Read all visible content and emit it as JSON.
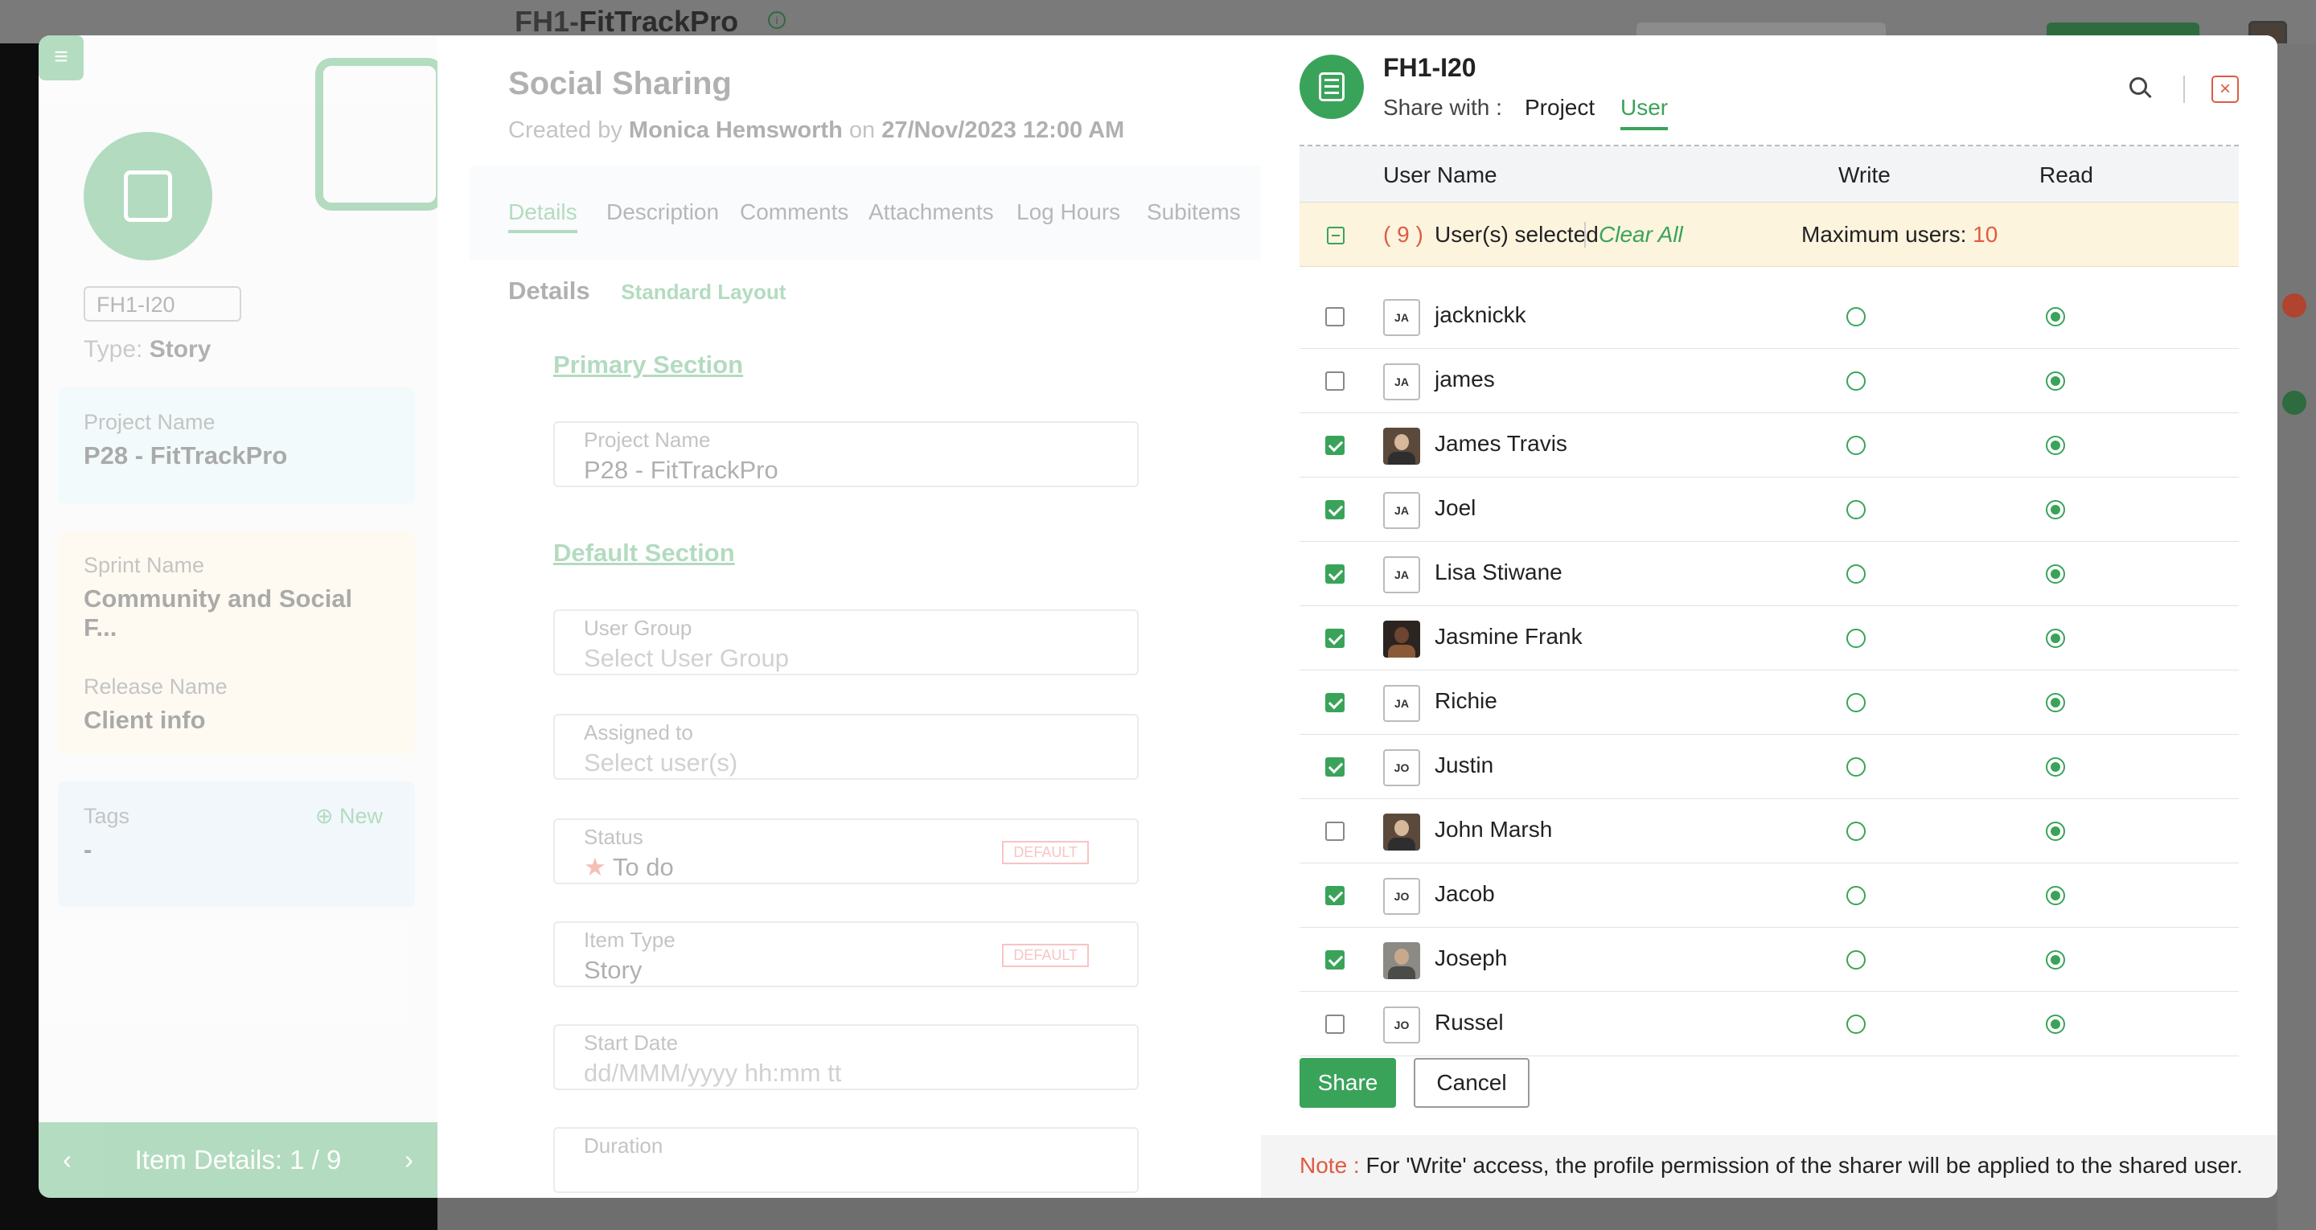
{
  "app": {
    "title_prefix": "FH1-",
    "title": "FitTrackPro"
  },
  "item": {
    "id": "FH1-I20",
    "type_label": "Type:",
    "type": "Story",
    "project_label": "Project Name",
    "project": "P28 - FitTrackPro",
    "sprint_label": "Sprint Name",
    "sprint": "Community and Social F...",
    "release_label": "Release Name",
    "release": "Client info",
    "tags_label": "Tags",
    "tags_new": "New",
    "tags_value": "-",
    "nav": "Item Details:  1 / 9"
  },
  "detail": {
    "title": "Social Sharing",
    "created_by_label": "Created by",
    "created_by": "Monica Hemsworth",
    "created_on_label": "on",
    "created_on": "27/Nov/2023 12:00 AM",
    "tabs": [
      "Details",
      "Description",
      "Comments",
      "Attachments",
      "Log Hours",
      "Subitems"
    ],
    "details_heading": "Details",
    "layout": "Standard Layout",
    "primary_section": "Primary Section",
    "default_section": "Default Section",
    "fields": {
      "project_name_label": "Project Name",
      "project_name": "P28 - FitTrackPro",
      "user_group_label": "User Group",
      "user_group_ph": "Select User Group",
      "assigned_label": "Assigned to",
      "assigned_ph": "Select user(s)",
      "status_label": "Status",
      "status": "To do",
      "item_type_label": "Item Type",
      "item_type": "Story",
      "default_tag": "DEFAULT",
      "start_date_label": "Start Date",
      "start_date_ph": "dd/MMM/yyyy hh:mm tt",
      "duration_label": "Duration"
    }
  },
  "share": {
    "title": "FH1-I20",
    "share_with_label": "Share with :",
    "tabs": [
      "Project",
      "User"
    ],
    "active_tab": "User",
    "columns": {
      "user": "User Name",
      "write": "Write",
      "read": "Read"
    },
    "selected_count": "( 9 )",
    "selected_text": "User(s) selected",
    "clear_all": "Clear All",
    "max_label": "Maximum users:",
    "max_value": "10",
    "users": [
      {
        "name": "jacknickk",
        "initials": "JA",
        "checked": false,
        "photo": "",
        "write": false,
        "read": true
      },
      {
        "name": "james",
        "initials": "JA",
        "checked": false,
        "photo": "",
        "write": false,
        "read": true
      },
      {
        "name": "James Travis",
        "initials": "",
        "checked": true,
        "photo": "photo",
        "write": false,
        "read": true
      },
      {
        "name": "Joel",
        "initials": "JA",
        "checked": true,
        "photo": "",
        "write": false,
        "read": true
      },
      {
        "name": "Lisa Stiwane",
        "initials": "JA",
        "checked": true,
        "photo": "",
        "write": false,
        "read": true
      },
      {
        "name": "Jasmine Frank",
        "initials": "",
        "checked": true,
        "photo": "photo dark",
        "write": false,
        "read": true
      },
      {
        "name": "Richie",
        "initials": "JA",
        "checked": true,
        "photo": "",
        "write": false,
        "read": true
      },
      {
        "name": "Justin",
        "initials": "JO",
        "checked": true,
        "photo": "",
        "write": false,
        "read": true
      },
      {
        "name": "John Marsh",
        "initials": "",
        "checked": false,
        "photo": "photo",
        "write": false,
        "read": true
      },
      {
        "name": "Jacob",
        "initials": "JO",
        "checked": true,
        "photo": "",
        "write": false,
        "read": true
      },
      {
        "name": "Joseph",
        "initials": "",
        "checked": true,
        "photo": "photo grey",
        "write": false,
        "read": true
      },
      {
        "name": "Russel",
        "initials": "JO",
        "checked": false,
        "photo": "",
        "write": false,
        "read": true
      }
    ],
    "share_button": "Share",
    "cancel_button": "Cancel",
    "note_label": "Note :",
    "note_text": "For 'Write' access, the profile permission of the sharer will be applied to the shared user."
  },
  "colors": {
    "accent": "#3aa35a",
    "danger": "#e05a43",
    "selection_bg": "#fdf4de"
  }
}
